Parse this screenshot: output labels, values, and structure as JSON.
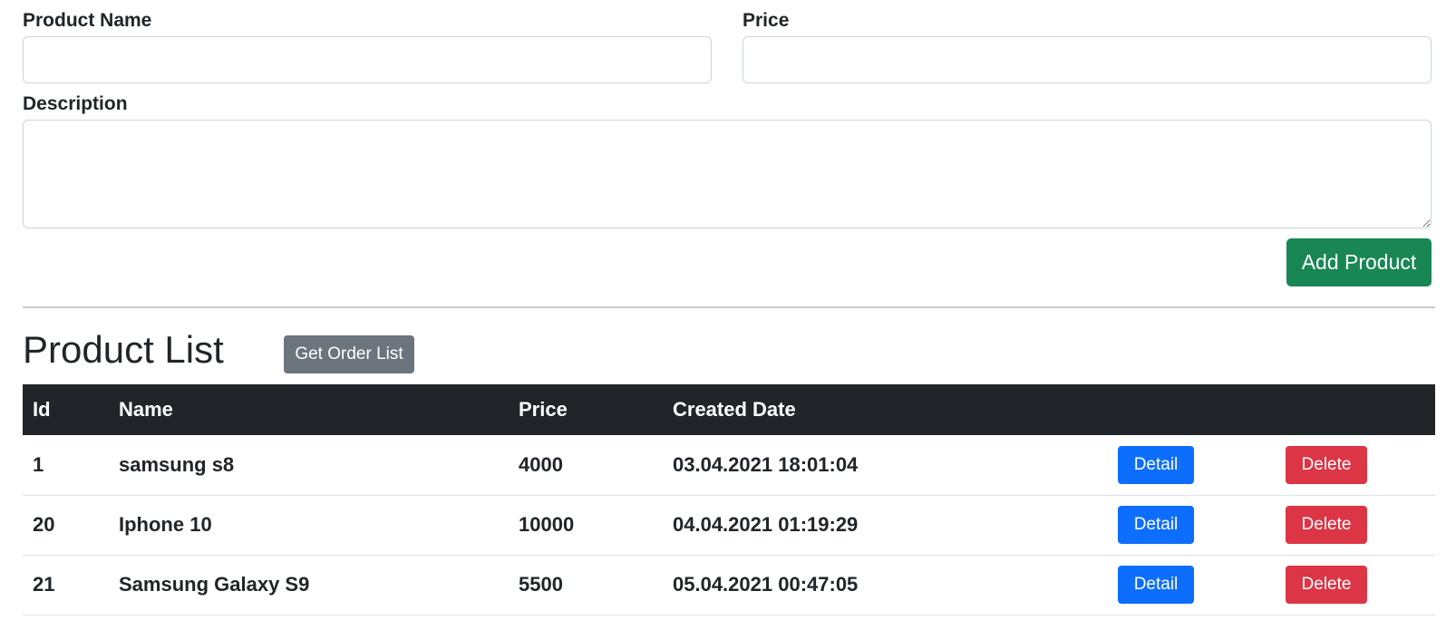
{
  "form": {
    "product_name_label": "Product Name",
    "product_name_value": "",
    "price_label": "Price",
    "price_value": "",
    "description_label": "Description",
    "description_value": "",
    "add_button_label": "Add Product"
  },
  "product_list": {
    "title": "Product List",
    "get_order_list_label": "Get Order List",
    "columns": [
      "Id",
      "Name",
      "Price",
      "Created Date",
      "",
      ""
    ],
    "rows": [
      {
        "id": "1",
        "name": "samsung s8",
        "price": "4000",
        "created": "03.04.2021 18:01:04",
        "detail": "Detail",
        "delete": "Delete"
      },
      {
        "id": "20",
        "name": "Iphone 10",
        "price": "10000",
        "created": "04.04.2021 01:19:29",
        "detail": "Detail",
        "delete": "Delete"
      },
      {
        "id": "21",
        "name": "Samsung Galaxy S9",
        "price": "5500",
        "created": "05.04.2021 00:47:05",
        "detail": "Detail",
        "delete": "Delete"
      }
    ]
  },
  "colors": {
    "success": "#198754",
    "secondary": "#6c757d",
    "primary": "#0d6efd",
    "danger": "#dc3545",
    "table_header": "#212529"
  }
}
